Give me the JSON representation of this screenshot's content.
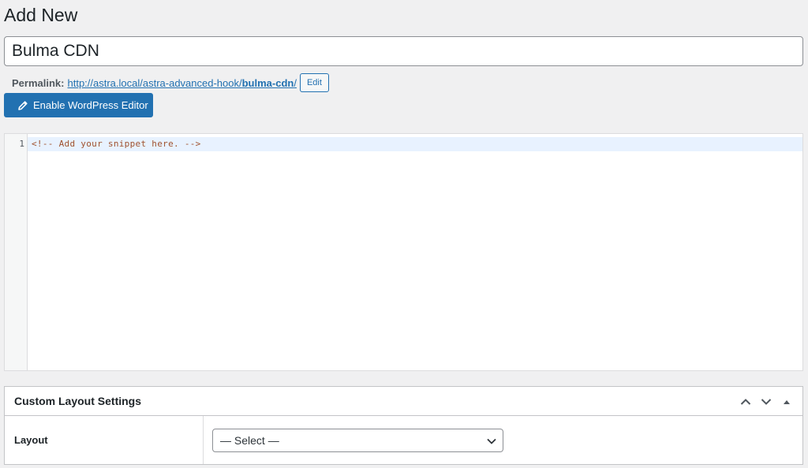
{
  "header": {
    "title": "Add New"
  },
  "post": {
    "title_value": "Bulma CDN"
  },
  "permalink": {
    "label": "Permalink:",
    "url_base": "http://astra.local/astra-advanced-hook/",
    "slug": "bulma-cdn",
    "trailing": "/",
    "edit_label": "Edit"
  },
  "toolbar": {
    "enable_editor_label": "Enable WordPress Editor"
  },
  "code_editor": {
    "line_number": "1",
    "content": "<!-- Add your snippet here. -->"
  },
  "layout_settings": {
    "title": "Custom Layout Settings",
    "layout_label": "Layout",
    "layout_selected": "— Select —"
  },
  "colors": {
    "primary": "#2271b1",
    "background": "#f0f0f1",
    "comment": "#a0522d"
  },
  "icons": [
    "pencil-icon",
    "chevron-up-icon",
    "chevron-down-icon",
    "triangle-up-icon",
    "select-chevron-icon"
  ]
}
